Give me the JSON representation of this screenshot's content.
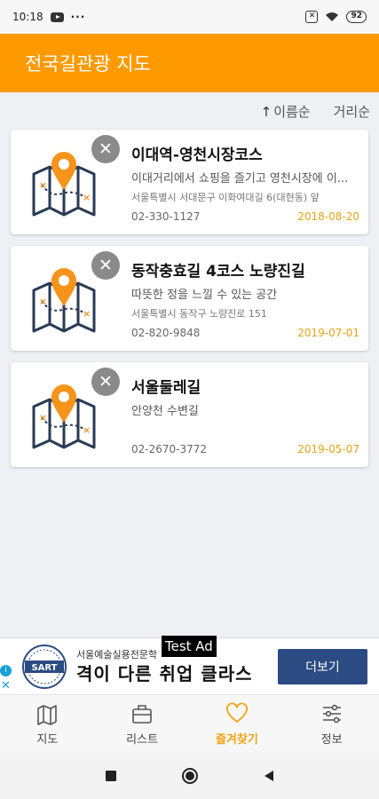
{
  "status_bar": {
    "time": "10:18",
    "battery": "92",
    "dots": "···"
  },
  "app_bar": {
    "title": "전국길관광 지도"
  },
  "sort": {
    "by_name": "이름순",
    "by_distance": "거리순"
  },
  "cards": [
    {
      "title": "이대역-영천시장코스",
      "desc": "이대거리에서 쇼핑을 즐기고 영천시장에 이...",
      "addr": "서울특별시 서대문구 이화여대길 6(대현동) 앞",
      "phone": "02-330-1127",
      "date": "2018-08-20",
      "delete": "✕"
    },
    {
      "title": "동작충효길 4코스 노량진길",
      "desc": "따뜻한 정을 느낄 수 있는 공간",
      "addr": "서울특별시 동작구 노량진로 151",
      "phone": "02-820-9848",
      "date": "2019-07-01",
      "delete": "✕"
    },
    {
      "title": "서울둘레길",
      "desc": "안양천 수변길",
      "addr": "",
      "phone": "02-2670-3772",
      "date": "2019-05-07",
      "delete": "✕"
    }
  ],
  "ad": {
    "sub": "서울예술실용전문학",
    "main": "격이 다른 취업 클라스",
    "button": "더보기",
    "test_label": "Test Ad",
    "logo_text": "SART",
    "info": "i",
    "close": "✕"
  },
  "bottom_nav": [
    {
      "label": "지도",
      "icon": "map-icon",
      "active": false
    },
    {
      "label": "리스트",
      "icon": "briefcase-icon",
      "active": false
    },
    {
      "label": "즐겨찾기",
      "icon": "heart-icon",
      "active": true
    },
    {
      "label": "정보",
      "icon": "sliders-icon",
      "active": false
    }
  ],
  "colors": {
    "accent": "#ff9900",
    "date": "#e6a21a",
    "ad_button": "#2b4b82"
  }
}
